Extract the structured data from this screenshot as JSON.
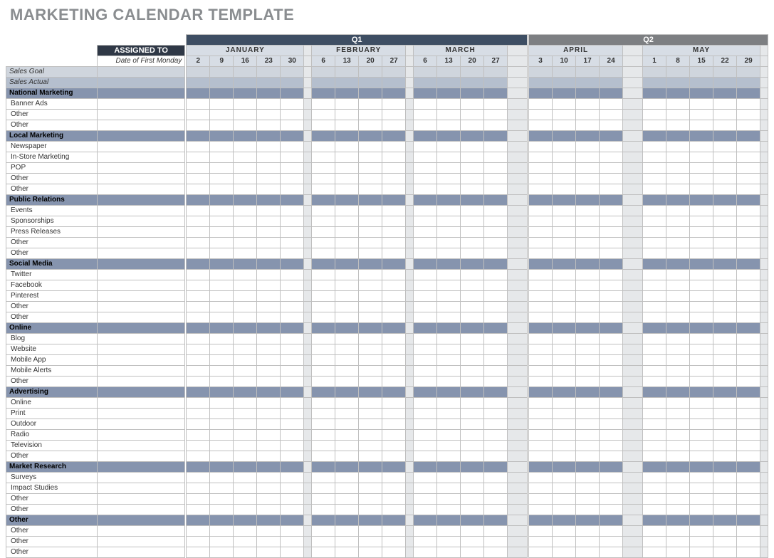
{
  "title": "MARKETING CALENDAR TEMPLATE",
  "assigned_to": "ASSIGNED TO",
  "date_label": "Date of First Monday",
  "quarters": [
    "Q1",
    "Q2"
  ],
  "months": [
    {
      "name": "JANUARY",
      "dates": [
        "2",
        "9",
        "16",
        "23",
        "30"
      ]
    },
    {
      "name": "FEBRUARY",
      "dates": [
        "6",
        "13",
        "20",
        "27"
      ]
    },
    {
      "name": "MARCH",
      "dates": [
        "6",
        "13",
        "20",
        "27"
      ]
    },
    {
      "name": "APRIL",
      "dates": [
        "3",
        "10",
        "17",
        "24"
      ]
    },
    {
      "name": "MAY",
      "dates": [
        "1",
        "8",
        "15",
        "22",
        "29"
      ]
    }
  ],
  "sales_goal": "Sales Goal",
  "sales_actual": "Sales Actual",
  "categories": [
    {
      "name": "National Marketing",
      "items": [
        "Banner Ads",
        "Other",
        "Other"
      ]
    },
    {
      "name": "Local Marketing",
      "items": [
        "Newspaper",
        "In-Store Marketing",
        "POP",
        "Other",
        "Other"
      ]
    },
    {
      "name": "Public Relations",
      "items": [
        "Events",
        "Sponsorships",
        "Press Releases",
        "Other",
        "Other"
      ]
    },
    {
      "name": "Social Media",
      "items": [
        "Twitter",
        "Facebook",
        "Pinterest",
        "Other",
        "Other"
      ]
    },
    {
      "name": "Online",
      "items": [
        "Blog",
        "Website",
        "Mobile App",
        "Mobile Alerts",
        "Other"
      ]
    },
    {
      "name": "Advertising",
      "items": [
        "Online",
        "Print",
        "Outdoor",
        "Radio",
        "Television",
        "Other"
      ]
    },
    {
      "name": "Market Research",
      "items": [
        "Surveys",
        "Impact Studies",
        "Other",
        "Other"
      ]
    },
    {
      "name": "Other",
      "items": [
        "Other",
        "Other",
        "Other"
      ]
    }
  ]
}
